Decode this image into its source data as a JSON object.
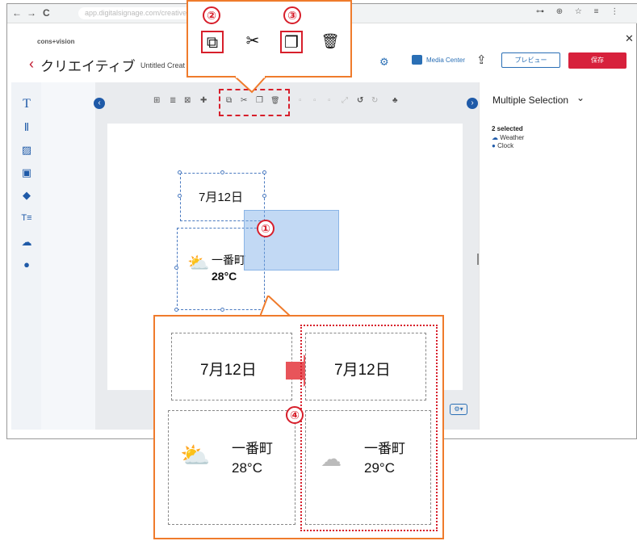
{
  "browser": {
    "nav_back": "←",
    "nav_forward": "→",
    "nav_reload": "C",
    "url": "app.digitalsignage.com/creative",
    "right_icons": "⊶ ⊕ ☆ ≡ ⋮"
  },
  "header": {
    "brand": "cons+vision",
    "back_icon": "‹",
    "title": "クリエイティブ",
    "untitled": "Untitled Creat",
    "media_center": "Media Center",
    "preview": "プレビュー",
    "save": "保存",
    "close": "✕"
  },
  "sidebar_tools": [
    {
      "icon": "text-icon",
      "glyph": "T"
    },
    {
      "icon": "textbox-icon",
      "glyph": "Ⅱ"
    },
    {
      "icon": "image-icon",
      "glyph": "▨"
    },
    {
      "icon": "video-icon",
      "glyph": "▣"
    },
    {
      "icon": "shapes-icon",
      "glyph": "◆"
    },
    {
      "icon": "ticker-icon",
      "glyph": "T≡"
    },
    {
      "icon": "weather-icon",
      "glyph": "☁"
    },
    {
      "icon": "clock-icon",
      "glyph": "●"
    }
  ],
  "toolbar": {
    "icons": [
      "⊞",
      "≣",
      "⊠",
      "✚",
      "⧉",
      "✂",
      "❐",
      "🗑",
      "▫",
      "▫",
      "▫",
      "⤢",
      "↺",
      "↻",
      "♣"
    ]
  },
  "right_panel": {
    "title": "Multiple Selection",
    "chevron": "⌄",
    "selected_count": "2 selected",
    "items": [
      "Weather",
      "Clock"
    ]
  },
  "canvas": {
    "date_text": "7月12日",
    "weather_place": "一番町",
    "weather_temp": "28°C"
  },
  "callout_top": {
    "num2": "②",
    "num3": "③",
    "copy_icon": "⧉",
    "cut_icon": "✂",
    "paste_icon": "❐",
    "delete_icon": "🗑"
  },
  "callout_bottom": {
    "num1": "①",
    "num4": "④",
    "orig_date": "7月12日",
    "orig_place": "一番町",
    "orig_temp": "28°C",
    "copy_date": "7月12日",
    "copy_place": "一番町",
    "copy_temp": "29°C"
  },
  "colors": {
    "accent": "#1f5aa8",
    "save": "#d7213c",
    "callout": "#ef7b2c",
    "highlight": "#d71f2b"
  }
}
